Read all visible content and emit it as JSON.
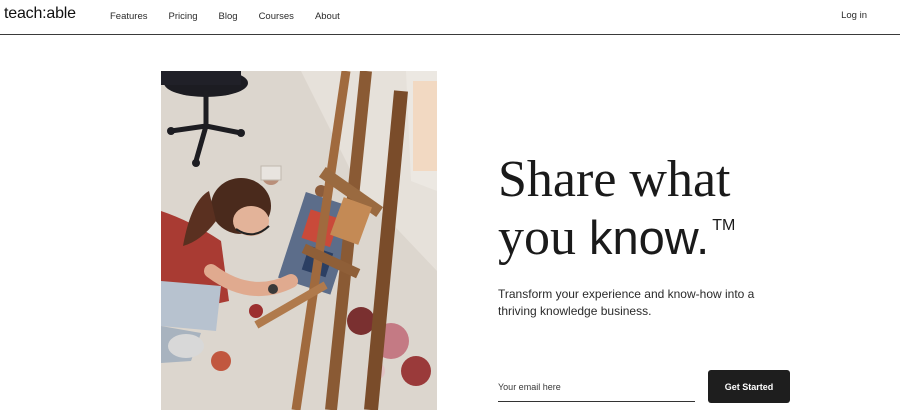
{
  "header": {
    "logo_text": "teach:able",
    "nav": [
      {
        "label": "Features"
      },
      {
        "label": "Pricing"
      },
      {
        "label": "Blog"
      },
      {
        "label": "Courses"
      },
      {
        "label": "About"
      }
    ],
    "login_label": "Log in"
  },
  "hero": {
    "headline_line1": "Share what",
    "headline_line2_serif": "you ",
    "headline_line2_sans": "know.",
    "headline_trademark": "TM",
    "subheading": "Transform your experience and know-how into a thriving knowledge business.",
    "photo_icon": "artist-painting-photo"
  },
  "signup": {
    "email_placeholder": "Your email here",
    "email_value": "",
    "cta_label": "Get Started"
  },
  "colors": {
    "text": "#1a1a1a",
    "button_bg": "#1e1e1e",
    "button_text": "#ffffff",
    "border": "#3a3a3a"
  }
}
